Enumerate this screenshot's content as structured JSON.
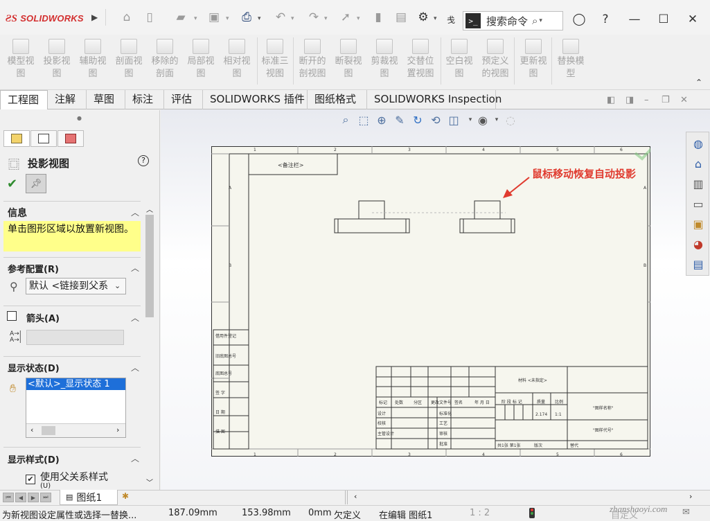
{
  "app": {
    "brand": "SOLIDWORKS",
    "search_placeholder": "搜索命令",
    "truncated_menu": "戋"
  },
  "ribbon": [
    {
      "label": "模型视\n图"
    },
    {
      "label": "投影视\n图"
    },
    {
      "label": "辅助视\n图"
    },
    {
      "label": "剖面视\n图"
    },
    {
      "label": "移除的\n剖面"
    },
    {
      "label": "局部视\n图"
    },
    {
      "label": "相对视\n图"
    },
    {
      "label": "标准三\n视图"
    },
    {
      "label": "断开的\n剖视图"
    },
    {
      "label": "断裂视\n图"
    },
    {
      "label": "剪裁视\n图"
    },
    {
      "label": "交替位\n置视图"
    },
    {
      "label": "空白视\n图"
    },
    {
      "label": "预定义\n的视图"
    },
    {
      "label": "更新视\n图"
    },
    {
      "label": "替换模\n型"
    }
  ],
  "tabs": [
    {
      "label": "工程图",
      "active": true
    },
    {
      "label": "注解"
    },
    {
      "label": "草图"
    },
    {
      "label": "标注"
    },
    {
      "label": "评估"
    },
    {
      "label": "SOLIDWORKS 插件"
    },
    {
      "label": "图纸格式"
    },
    {
      "label": "SOLIDWORKS Inspection"
    }
  ],
  "property_manager": {
    "title": "投影视图",
    "info_title": "信息",
    "info_text": "单击图形区域以放置新视图。",
    "ref_config_title": "参考配置(R)",
    "ref_config_value": "默认 <链接到父系",
    "arrow_title": "箭头(A)",
    "display_state_title": "显示状态(D)",
    "display_state_item": "<默认>_显示状态 1",
    "display_style_title": "显示样式(D)",
    "use_parent_style": "使用父关系样式",
    "use_parent_style_suffix": "(U)"
  },
  "annotation": "鼠标移动恢复自动投影",
  "sheet": {
    "title_box": "<备注栏>",
    "rows": [
      "A",
      "B"
    ],
    "cols": [
      "1",
      "2",
      "3",
      "4",
      "5",
      "6"
    ],
    "left_labels": [
      "借用件登记",
      "旧底图总号",
      "底图总号",
      "签  字",
      "日  期",
      "描  图"
    ],
    "material": "材料 <未指定>",
    "stage_label": "阶 段 标 记",
    "weight_label": "质量",
    "scale_label": "比例",
    "weight_value": "2.174",
    "scale_value": "1:1",
    "name_label": "\"图样名称\"",
    "code_label": "\"图样代号\"",
    "sheet_count": "共1张   第1张",
    "edition": "版次",
    "alt": "替代",
    "headers": [
      "标记",
      "处数",
      "分区",
      "更改文件号",
      "签名",
      "年 月 日"
    ],
    "roles": [
      "设计",
      "校核",
      "主管设计"
    ],
    "roles2": [
      "标准化",
      "工艺",
      "审核",
      "批准"
    ]
  },
  "sheet_tab": "图纸1",
  "status": {
    "message": "为新视图设定属性或选择一替换...",
    "x": "187.09mm",
    "y": "153.98mm",
    "z": "0mm",
    "define": "欠定义",
    "editing": "在编辑 图纸1",
    "scale": "1 : 2",
    "custom": "自定义"
  },
  "watermark": "zhanshaoyi.com",
  "colors": {
    "accent": "#1e6fd9",
    "annotation": "#e03b2f",
    "info_bg": "#ffff8a",
    "logo": "#d32f2f"
  }
}
